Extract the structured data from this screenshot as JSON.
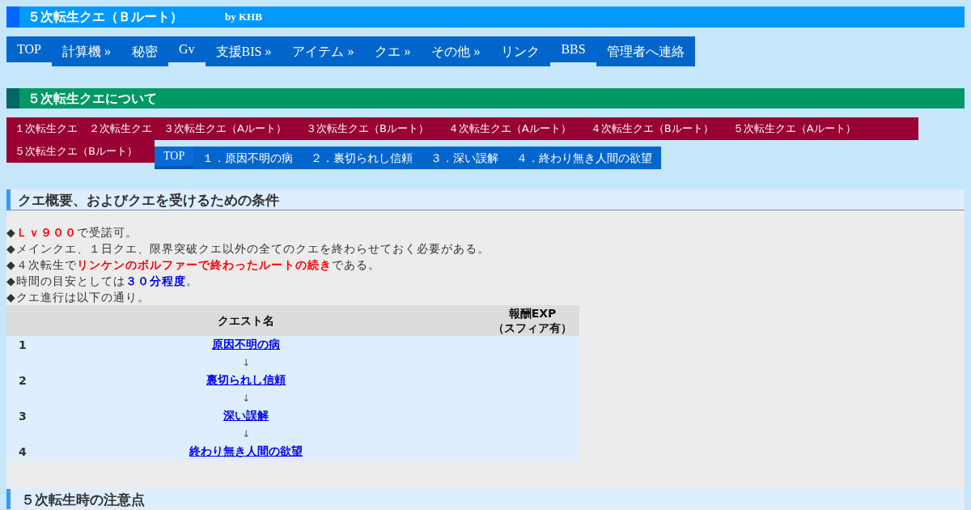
{
  "header": {
    "title": "５次転生クエ（Ｂルート）",
    "byline": "by KHB"
  },
  "nav": [
    {
      "label": "TOP",
      "underlined": true
    },
    {
      "label": "計算機 »",
      "underlined": false
    },
    {
      "label": "秘密",
      "underlined": false
    },
    {
      "label": "Gv",
      "underlined": true
    },
    {
      "label": "支援BIS »",
      "underlined": false
    },
    {
      "label": "アイテム »",
      "underlined": false
    },
    {
      "label": "クエ »",
      "underlined": false
    },
    {
      "label": "その他 »",
      "underlined": false
    },
    {
      "label": "リンク",
      "underlined": false
    },
    {
      "label": "BBS",
      "underlined": true
    },
    {
      "label": "管理者へ連絡",
      "underlined": false
    }
  ],
  "section_banner": "５次転生クエについて",
  "quest_links": [
    "１次転生クエ",
    "２次転生クエ",
    "３次転生クエ（Aルート）",
    "３次転生クエ（Bルート）",
    "４次転生クエ（Aルート）",
    "４次転生クエ（Bルート）",
    "５次転生クエ（Aルート）",
    "５次転生クエ（Bルート）"
  ],
  "sub_nav": [
    {
      "label": "TOP",
      "underlined": true
    },
    {
      "label": "１．原因不明の病",
      "underlined": false
    },
    {
      "label": "２．裏切られし信頼",
      "underlined": false
    },
    {
      "label": "３．深い誤解",
      "underlined": false
    },
    {
      "label": "４．終わり無き人間の欲望",
      "underlined": false
    }
  ],
  "overview": {
    "heading": "クエ概要、およびクエを受けるための条件",
    "lines": [
      [
        {
          "text": "◆"
        },
        {
          "text": "Ｌｖ９００",
          "color": "#ff0000"
        },
        {
          "text": "で受諾可。"
        }
      ],
      [
        {
          "text": "◆メインクエ、１日クエ、限界突破クエ以外の全てのクエを終わらせておく必要がある。"
        }
      ],
      [
        {
          "text": "◆４次転生で"
        },
        {
          "text": "リンケンのボルファーで終わったルートの続き",
          "color": "#ff0000"
        },
        {
          "text": "である。"
        }
      ],
      [
        {
          "text": "◆時間の目安としては"
        },
        {
          "text": "３０分程度",
          "color": "#0000ee"
        },
        {
          "text": "。"
        }
      ],
      [
        {
          "text": "◆クエ進行は以下の通り。"
        }
      ]
    ],
    "table": {
      "columns": [
        "クエスト名",
        "報酬EXP\n（スフィア有）"
      ],
      "rows": [
        {
          "number": "1",
          "name": "原因不明の病",
          "arrow": "↓"
        },
        {
          "number": "2",
          "name": "裏切られし信頼",
          "arrow": "↓"
        },
        {
          "number": "3",
          "name": "深い誤解",
          "arrow": "↓"
        },
        {
          "number": "4",
          "name": "終わり無き人間の欲望"
        }
      ]
    }
  },
  "next_heading": "５次転生時の注意点"
}
